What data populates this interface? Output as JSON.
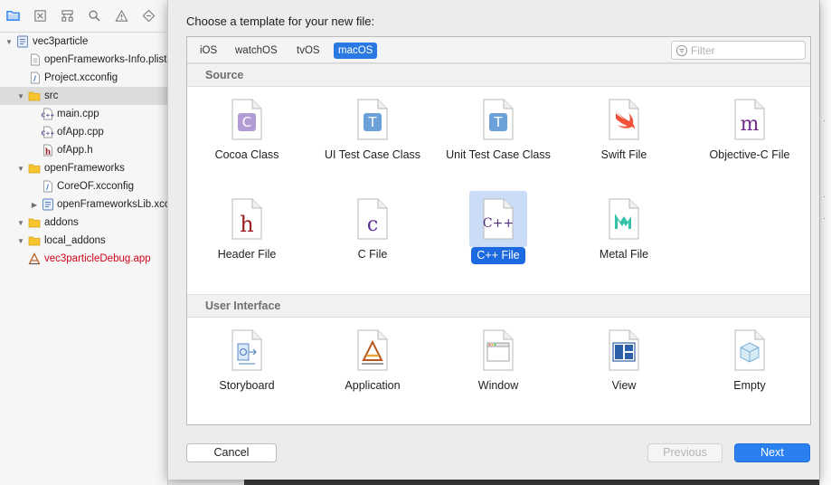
{
  "navigator": {
    "toolbar_icons": [
      "folder-icon",
      "warning-square-icon",
      "hierarchy-icon",
      "search-icon",
      "warning-triangle-icon",
      "test-diamond-icon"
    ],
    "tree": [
      {
        "label": "vec3particle",
        "icon": "project-icon",
        "depth": 0,
        "disclosure": "open"
      },
      {
        "label": "openFrameworks-Info.plist",
        "icon": "plist-file-icon",
        "depth": 1,
        "disclosure": "none"
      },
      {
        "label": "Project.xcconfig",
        "icon": "xcconfig-file-icon",
        "depth": 1,
        "disclosure": "none"
      },
      {
        "label": "src",
        "icon": "folder-icon",
        "depth": 1,
        "disclosure": "open",
        "selected": true
      },
      {
        "label": "main.cpp",
        "icon": "cpp-file-icon",
        "depth": 2,
        "disclosure": "none"
      },
      {
        "label": "ofApp.cpp",
        "icon": "cpp-file-icon",
        "depth": 2,
        "disclosure": "none"
      },
      {
        "label": "ofApp.h",
        "icon": "header-file-icon",
        "depth": 2,
        "disclosure": "none"
      },
      {
        "label": "openFrameworks",
        "icon": "folder-icon",
        "depth": 1,
        "disclosure": "open"
      },
      {
        "label": "CoreOF.xcconfig",
        "icon": "xcconfig-file-icon",
        "depth": 2,
        "disclosure": "none"
      },
      {
        "label": "openFrameworksLib.xcodeproj",
        "icon": "xcodeproj-icon",
        "depth": 2,
        "disclosure": "closed"
      },
      {
        "label": "addons",
        "icon": "folder-icon",
        "depth": 1,
        "disclosure": "open"
      },
      {
        "label": "local_addons",
        "icon": "folder-icon",
        "depth": 1,
        "disclosure": "open"
      },
      {
        "label": "vec3particleDebug.app",
        "icon": "app-icon",
        "depth": 1,
        "disclosure": "none",
        "color": "#d0021b"
      }
    ]
  },
  "sheet": {
    "title": "Choose a template for your new file:",
    "platform_tabs": [
      {
        "label": "iOS",
        "active": false
      },
      {
        "label": "watchOS",
        "active": false
      },
      {
        "label": "tvOS",
        "active": false
      },
      {
        "label": "macOS",
        "active": true
      }
    ],
    "filter": {
      "placeholder": "Filter",
      "value": ""
    },
    "sections": [
      {
        "title": "Source",
        "templates": [
          {
            "label": "Cocoa Class",
            "icon": "cocoa-class-icon"
          },
          {
            "label": "UI Test Case Class",
            "icon": "ui-test-case-icon"
          },
          {
            "label": "Unit Test Case Class",
            "icon": "unit-test-case-icon"
          },
          {
            "label": "Swift File",
            "icon": "swift-file-icon"
          },
          {
            "label": "Objective-C File",
            "icon": "objc-file-icon"
          },
          {
            "label": "Header File",
            "icon": "header-file-icon"
          },
          {
            "label": "C File",
            "icon": "c-file-icon"
          },
          {
            "label": "C++ File",
            "icon": "cpp-file-icon",
            "selected": true
          },
          {
            "label": "Metal File",
            "icon": "metal-file-icon"
          }
        ]
      },
      {
        "title": "User Interface",
        "templates": [
          {
            "label": "Storyboard",
            "icon": "storyboard-icon"
          },
          {
            "label": "Application",
            "icon": "application-icon"
          },
          {
            "label": "Window",
            "icon": "window-icon"
          },
          {
            "label": "View",
            "icon": "view-icon"
          },
          {
            "label": "Empty",
            "icon": "empty-icon"
          }
        ]
      }
    ],
    "buttons": {
      "cancel": "Cancel",
      "previous": "Previous",
      "next": "Next"
    }
  },
  "colors": {
    "accent": "#2b80f0",
    "selection_label": "#1d6ae0",
    "selection_icon_bg": "#cbdcf6",
    "error_red": "#d0021b"
  }
}
